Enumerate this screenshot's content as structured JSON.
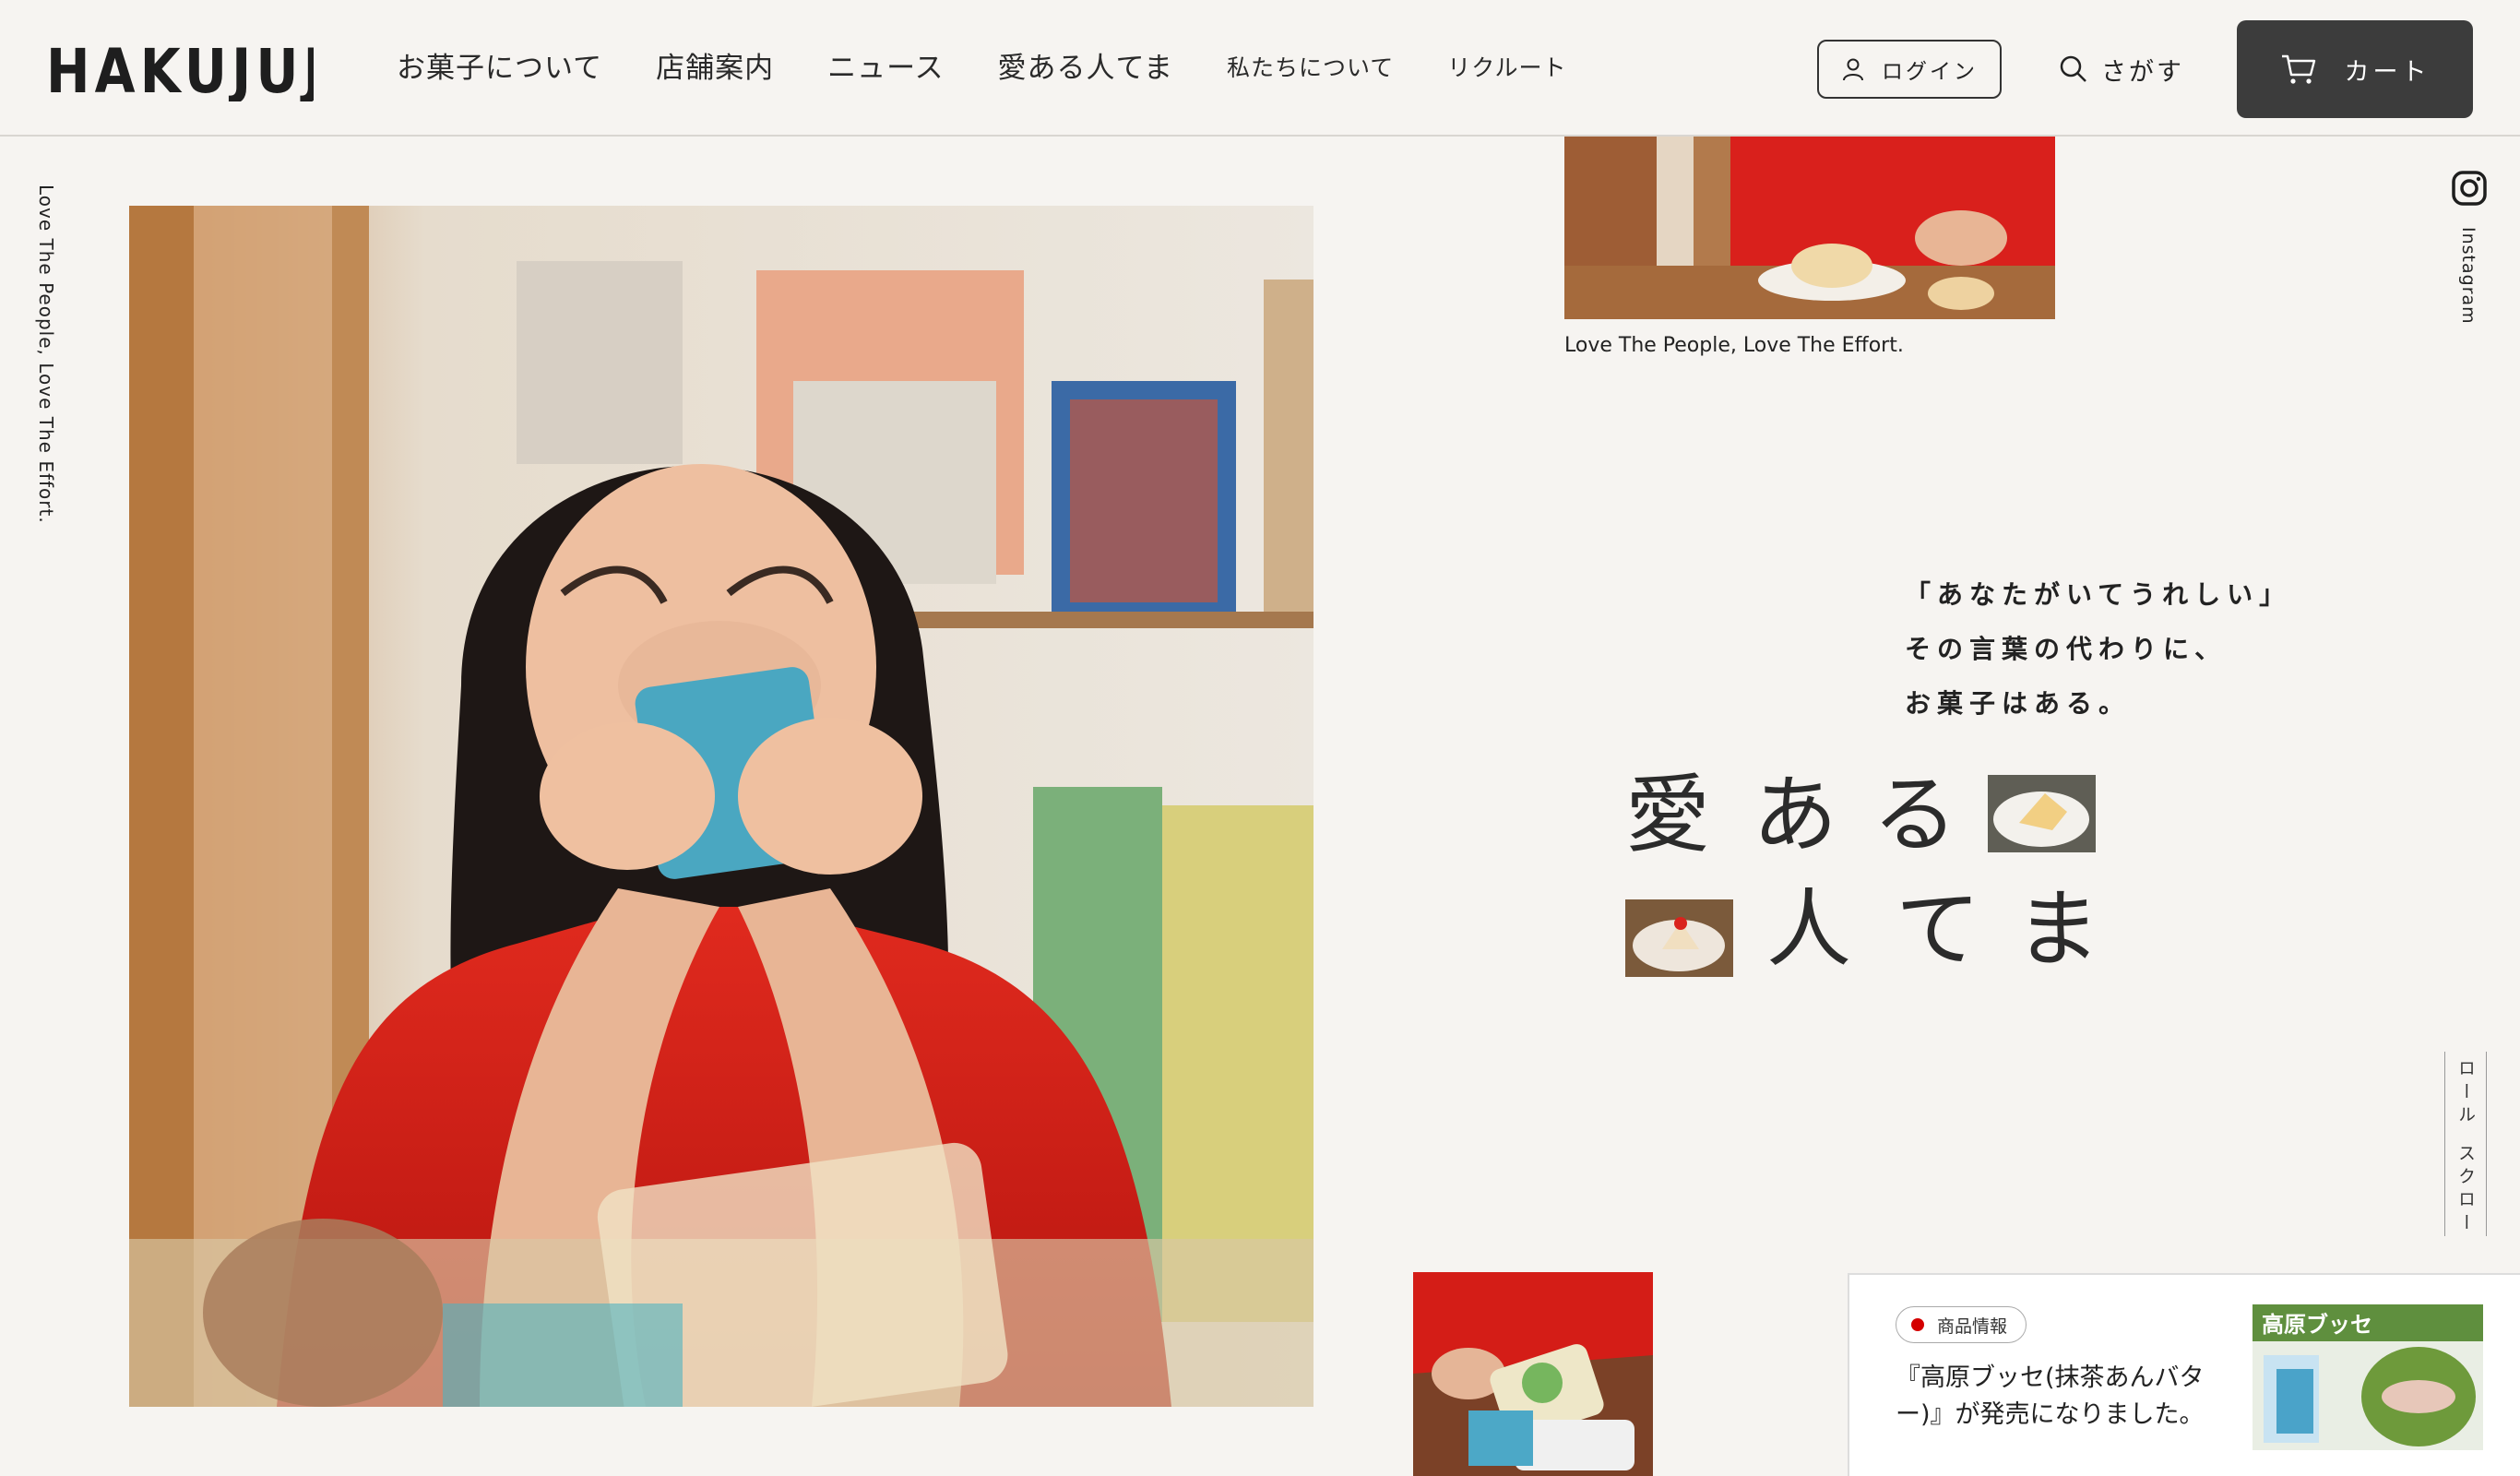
{
  "header": {
    "logo_text": "HAKUJUJI",
    "nav": [
      {
        "label": "お菓子について",
        "size": "big"
      },
      {
        "label": "店舗案内",
        "size": "big"
      },
      {
        "label": "ニュース",
        "size": "big"
      },
      {
        "label": "愛ある人てま",
        "size": "big"
      },
      {
        "label": "私たちについて",
        "size": "small"
      },
      {
        "label": "リクルート",
        "size": "small"
      }
    ],
    "login_label": "ログイン",
    "search_label": "さがす",
    "cart_label": "カート"
  },
  "side": {
    "left_vertical_text": "Love The People, Love The Effort.",
    "instagram_label": "Instagram",
    "scroll_top": "ロール",
    "scroll_bottom": "スクロー"
  },
  "hero": {
    "caption": "Love The People, Love The Effort.",
    "copy_lines": [
      "「あなたがいてうれしい」",
      "その言葉の代わりに、",
      "お菓子はある。"
    ],
    "title_chars": [
      "愛",
      "あ",
      "る",
      "人",
      "て",
      "ま"
    ]
  },
  "news": {
    "badge": "商品情報",
    "title": "『高原ブッセ(抹茶あんバター)』が発売になりました。",
    "image_text": "高原ブッセ"
  },
  "colors": {
    "background": "#f6f4f1",
    "cart_bg": "#3c3c3c",
    "badge_dot": "#d40000"
  }
}
